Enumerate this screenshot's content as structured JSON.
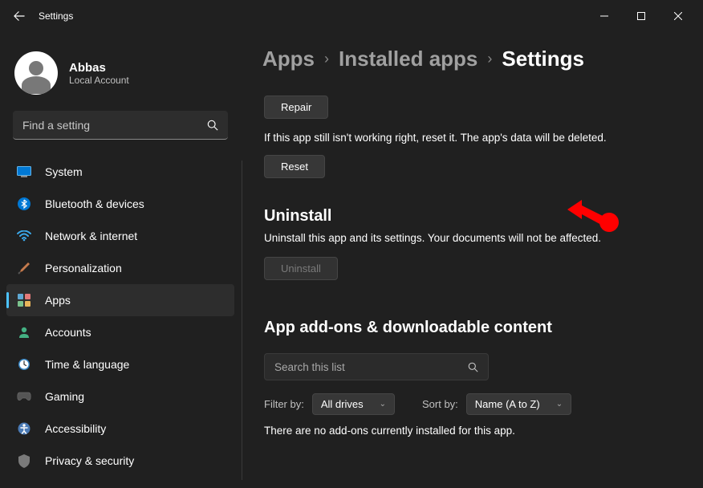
{
  "window": {
    "title": "Settings"
  },
  "user": {
    "name": "Abbas",
    "type": "Local Account"
  },
  "search": {
    "placeholder": "Find a setting"
  },
  "nav": {
    "items": [
      {
        "label": "System"
      },
      {
        "label": "Bluetooth & devices"
      },
      {
        "label": "Network & internet"
      },
      {
        "label": "Personalization"
      },
      {
        "label": "Apps"
      },
      {
        "label": "Accounts"
      },
      {
        "label": "Time & language"
      },
      {
        "label": "Gaming"
      },
      {
        "label": "Accessibility"
      },
      {
        "label": "Privacy & security"
      }
    ]
  },
  "breadcrumb": {
    "l1": "Apps",
    "l2": "Installed apps",
    "current": "Settings"
  },
  "main": {
    "repair_label": "Repair",
    "reset_desc": "If this app still isn't working right, reset it. The app's data will be deleted.",
    "reset_label": "Reset",
    "uninstall_title": "Uninstall",
    "uninstall_desc": "Uninstall this app and its settings. Your documents will not be affected.",
    "uninstall_label": "Uninstall",
    "addons_title": "App add-ons & downloadable content",
    "addons_search_placeholder": "Search this list",
    "filter_label": "Filter by:",
    "filter_value": "All drives",
    "sort_label": "Sort by:",
    "sort_value": "Name (A to Z)",
    "addons_empty": "There are no add-ons currently installed for this app."
  }
}
